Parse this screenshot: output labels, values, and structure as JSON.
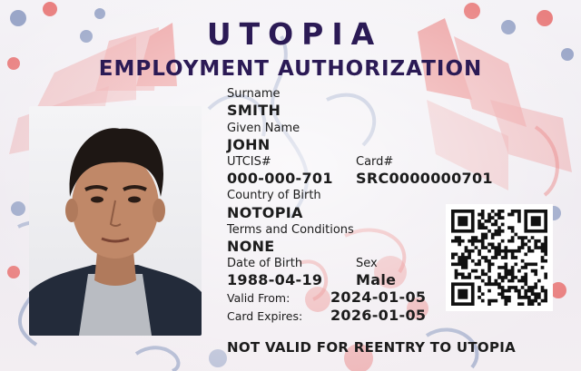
{
  "card": {
    "country": "UTOPIA",
    "doc_type": "EMPLOYMENT AUTHORIZATION",
    "fields": {
      "surname_label": "Surname",
      "surname": "SMITH",
      "given_name_label": "Given Name",
      "given_name": "JOHN",
      "utcis_label": "UTCIS#",
      "utcis": "000-000-701",
      "card_label": "Card#",
      "card": "SRC0000000701",
      "country_of_birth_label": "Country of Birth",
      "country_of_birth": "NOTOPIA",
      "terms_label": "Terms and Conditions",
      "terms": "NONE",
      "dob_label": "Date of Birth",
      "dob": "1988-04-19",
      "sex_label": "Sex",
      "sex": "Male",
      "valid_from_label": "Valid From:",
      "valid_from": "2024-01-05",
      "expires_label": "Card Expires:",
      "expires": "2026-01-05"
    },
    "footer": "NOT VALID FOR REENTRY TO UTOPIA"
  },
  "colors": {
    "title": "#2b1a55",
    "pattern_red": "#e98080",
    "pattern_blue": "#9aa6c8",
    "text": "#1c1c1c"
  }
}
